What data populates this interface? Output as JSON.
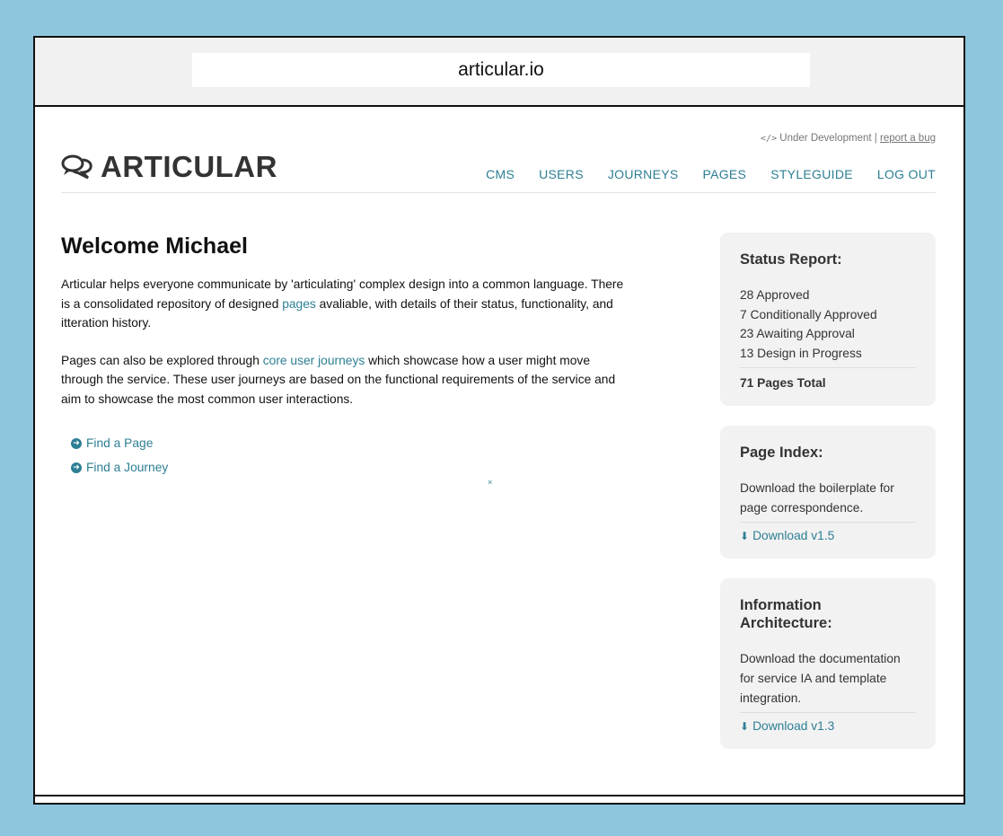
{
  "browser": {
    "url": "articular.io"
  },
  "header": {
    "dev_status": "Under Development",
    "separator": "|",
    "report_bug": "report a bug",
    "logo_text": "ARTICULAR",
    "nav": [
      "CMS",
      "USERS",
      "JOURNEYS",
      "PAGES",
      "STYLEGUIDE",
      "LOG OUT"
    ]
  },
  "main": {
    "title": "Welcome Michael",
    "p1_before": "Articular helps everyone communicate by 'articulating' complex design into a common language. There is a consolidated repository of designed ",
    "p1_link": "pages",
    "p1_after": " avaliable, with details of their status, functionality, and itteration history.",
    "p2_before": "Pages can also be explored through ",
    "p2_link": "core user journeys",
    "p2_after": " which showcase how a user might move through the service. These user journeys are based on the functional requirements of the service and aim to showcase the most common user interactions.",
    "links": [
      "Find a Page",
      "Find a Journey"
    ],
    "stray_mark": "×"
  },
  "sidebar": {
    "status": {
      "title": "Status Report:",
      "items": [
        "28 Approved",
        "7 Conditionally Approved",
        "23 Awaiting Approval",
        "13 Design in Progress"
      ],
      "total": "71 Pages Total"
    },
    "index": {
      "title": "Page Index:",
      "text": "Download the boilerplate for page correspondence.",
      "download": "Download v1.5"
    },
    "ia": {
      "title": "Information Architecture:",
      "text": "Download the documentation for service IA and template integration.",
      "download": "Download v1.3"
    }
  }
}
